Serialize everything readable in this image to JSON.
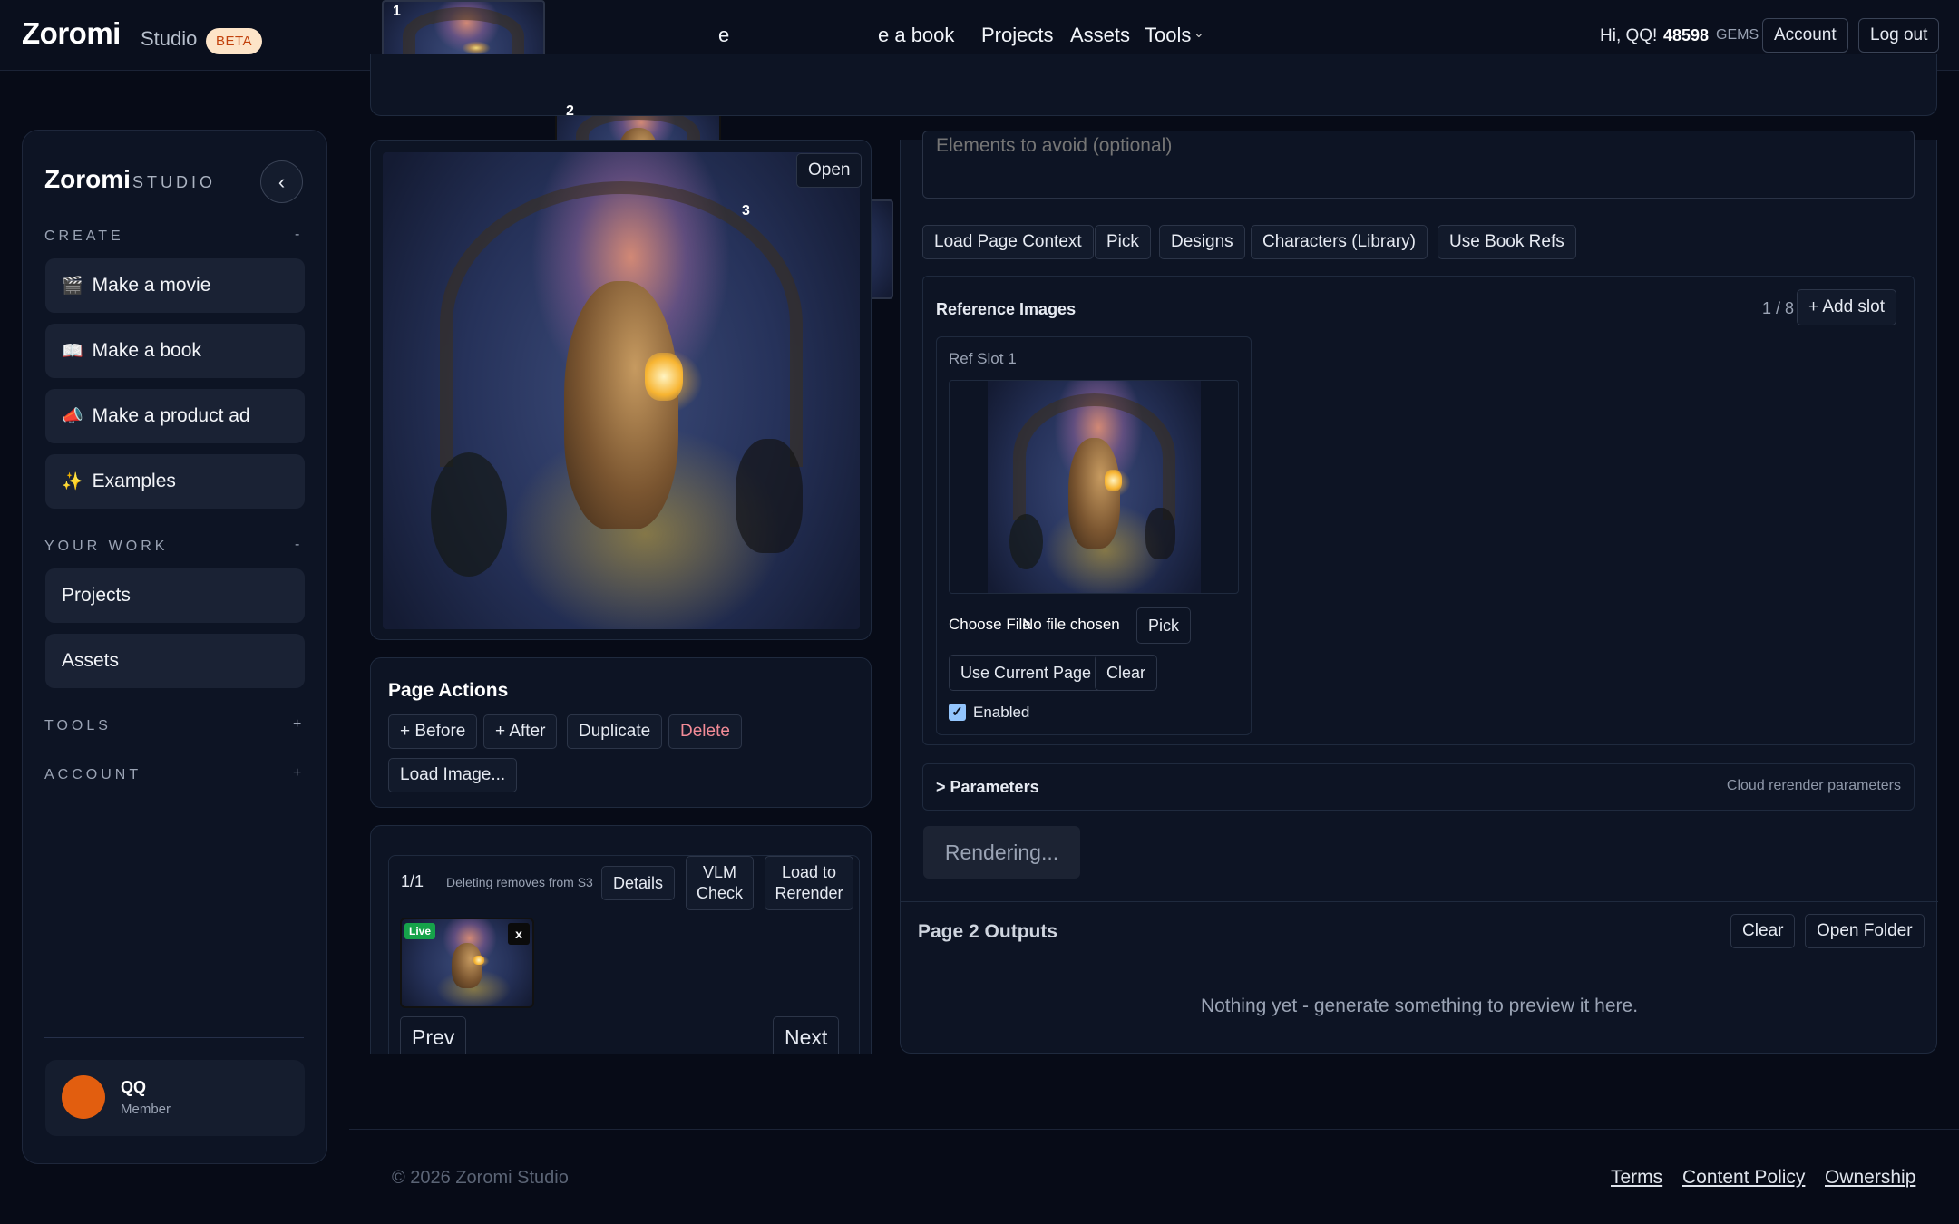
{
  "header": {
    "logo": "Zoromi",
    "studio": "Studio",
    "beta": "BETA",
    "nav": [
      "e",
      "e a book",
      "Projects",
      "Assets",
      "Tools"
    ],
    "greeting": "Hi, QQ!",
    "gems": "48598",
    "gems_unit": "GEMS",
    "account": "Account",
    "logout": "Log out",
    "thumbs": [
      "1",
      "2",
      "3"
    ]
  },
  "sidebar": {
    "logo": "Zoromi",
    "studio": "STUDIO",
    "sections": {
      "create": "CREATE",
      "create_toggle": "-",
      "your_work": "YOUR WORK",
      "your_work_toggle": "-",
      "tools": "TOOLS",
      "tools_toggle": "+",
      "account": "ACCOUNT",
      "account_toggle": "+"
    },
    "create_items": [
      {
        "emoji": "🎬",
        "label": "Make a movie"
      },
      {
        "emoji": "📖",
        "label": "Make a book"
      },
      {
        "emoji": "📣",
        "label": "Make a product ad"
      },
      {
        "emoji": "✨",
        "label": "Examples"
      }
    ],
    "work_items": [
      "Projects",
      "Assets"
    ],
    "user": {
      "name": "QQ",
      "role": "Member"
    }
  },
  "preview": {
    "open": "Open"
  },
  "page_actions": {
    "title": "Page Actions",
    "before": "+ Before",
    "after": "+ After",
    "duplicate": "Duplicate",
    "delete": "Delete",
    "load_image": "Load Image..."
  },
  "versions": {
    "count": "1/1",
    "note": "Deleting removes from S3",
    "details": "Details",
    "vlm": "VLM\nCheck",
    "load": "Load to\nRerender",
    "live": "Live",
    "close": "x",
    "prev": "Prev",
    "next": "Next"
  },
  "right": {
    "avoid_placeholder": "Elements to avoid (optional)",
    "tools": [
      "Load Page Context",
      "Pick",
      "Designs",
      "Characters (Library)",
      "Use Book Refs"
    ],
    "refs": {
      "title": "Reference Images",
      "count": "1 / 8",
      "add": "+ Add slot",
      "slot_title": "Ref Slot 1",
      "choose": "Choose File",
      "no_file": "No file chosen",
      "pick": "Pick",
      "use_current": "Use Current Page",
      "clear": "Clear",
      "enabled": "Enabled"
    },
    "params": {
      "label": "> Parameters",
      "hint": "Cloud rerender parameters"
    },
    "rendering": "Rendering...",
    "outputs": {
      "title": "Page 2 Outputs",
      "clear": "Clear",
      "open_folder": "Open Folder",
      "empty": "Nothing yet - generate something to preview it here."
    }
  },
  "footer": {
    "copyright": "© 2026 Zoromi Studio",
    "links": [
      "Terms",
      "Content Policy",
      "Ownership"
    ]
  }
}
